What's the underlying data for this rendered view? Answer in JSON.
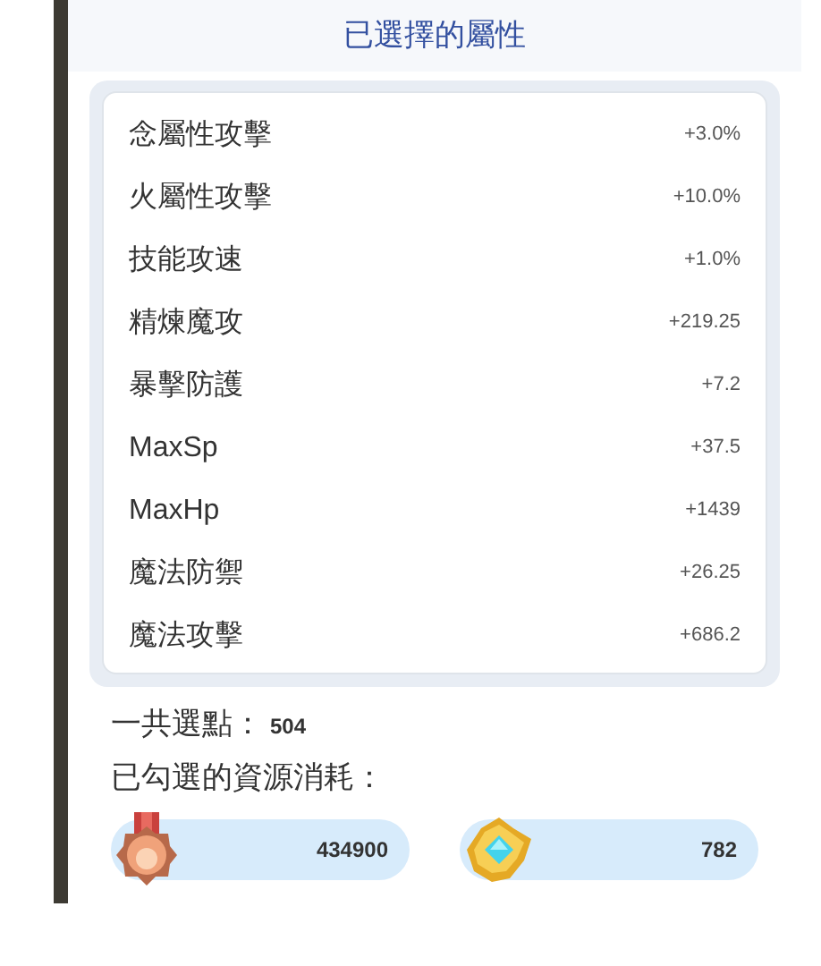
{
  "title": "已選擇的屬性",
  "attributes": [
    {
      "name": "念屬性攻擊",
      "value": "+3.0%"
    },
    {
      "name": "火屬性攻擊",
      "value": "+10.0%"
    },
    {
      "name": "技能攻速",
      "value": "+1.0%"
    },
    {
      "name": "精煉魔攻",
      "value": "+219.25"
    },
    {
      "name": "暴擊防護",
      "value": "+7.2"
    },
    {
      "name": "MaxSp",
      "value": "+37.5"
    },
    {
      "name": "MaxHp",
      "value": "+1439"
    },
    {
      "name": "魔法防禦",
      "value": "+26.25"
    },
    {
      "name": "魔法攻擊",
      "value": "+686.2"
    }
  ],
  "total_points": {
    "label": "一共選點：",
    "value": "504"
  },
  "cost_label": "已勾選的資源消耗：",
  "resources": [
    {
      "kind": "medal",
      "amount": "434900"
    },
    {
      "kind": "crystal",
      "amount": "782"
    }
  ]
}
